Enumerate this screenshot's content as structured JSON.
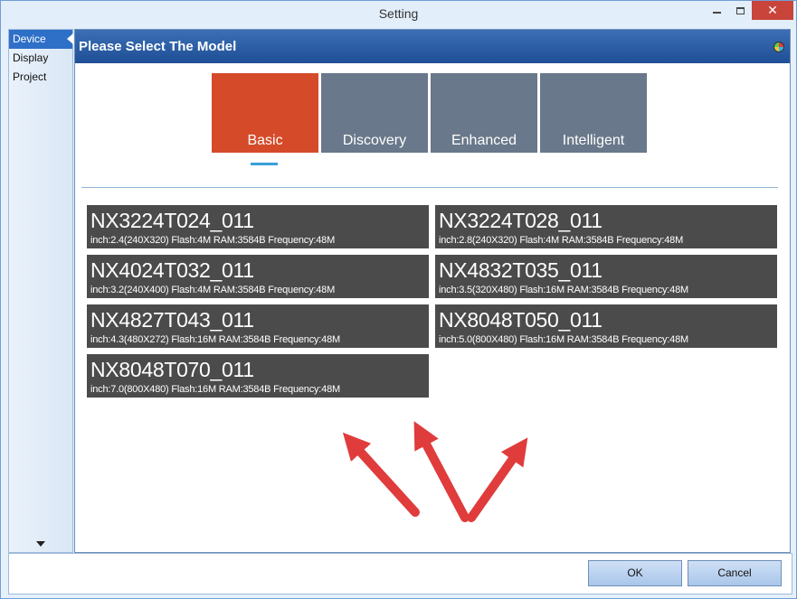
{
  "window": {
    "title": "Setting"
  },
  "sidebar": {
    "items": [
      {
        "label": "Device",
        "active": true
      },
      {
        "label": "Display",
        "active": false
      },
      {
        "label": "Project",
        "active": false
      }
    ]
  },
  "panel": {
    "title": "Please Select The Model"
  },
  "tabs": [
    {
      "label": "Basic",
      "active": true
    },
    {
      "label": "Discovery",
      "active": false
    },
    {
      "label": "Enhanced",
      "active": false
    },
    {
      "label": "Intelligent",
      "active": false
    }
  ],
  "models": [
    {
      "name": "NX3224T024_011",
      "spec": "inch:2.4(240X320) Flash:4M RAM:3584B Frequency:48M"
    },
    {
      "name": "NX3224T028_011",
      "spec": "inch:2.8(240X320) Flash:4M RAM:3584B Frequency:48M"
    },
    {
      "name": "NX4024T032_011",
      "spec": "inch:3.2(240X400) Flash:4M RAM:3584B Frequency:48M"
    },
    {
      "name": "NX4832T035_011",
      "spec": "inch:3.5(320X480) Flash:16M RAM:3584B Frequency:48M"
    },
    {
      "name": "NX4827T043_011",
      "spec": "inch:4.3(480X272) Flash:16M RAM:3584B Frequency:48M"
    },
    {
      "name": "NX8048T050_011",
      "spec": "inch:5.0(800X480) Flash:16M RAM:3584B Frequency:48M"
    },
    {
      "name": "NX8048T070_011",
      "spec": "inch:7.0(800X480) Flash:16M RAM:3584B Frequency:48M"
    }
  ],
  "footer": {
    "ok_label": "OK",
    "cancel_label": "Cancel"
  },
  "colors": {
    "active_tab": "#d54b2a",
    "inactive_tab": "#69788a",
    "model_tile": "#4b4b4b",
    "header": "#2a5ea6",
    "arrow": "#e03c3c"
  }
}
